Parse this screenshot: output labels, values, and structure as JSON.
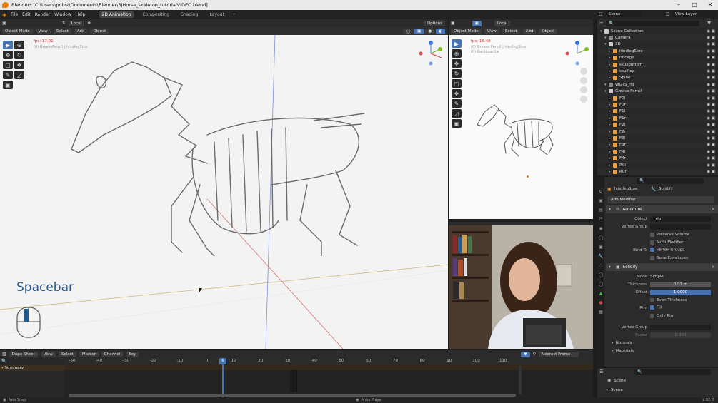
{
  "window": {
    "title": "Blender* [C:\\Users\\pobst\\Documents\\Blender\\3JHorse_skeleton_tutorialVIDEO.blend]"
  },
  "menu": [
    "File",
    "Edit",
    "Render",
    "Window",
    "Help"
  ],
  "workspaces": [
    "2D Animation",
    "Compositing",
    "Shading",
    "Layout"
  ],
  "scene_field": "Scene",
  "view_layer_field": "View Layer",
  "viewport_main": {
    "mode": "Object Mode",
    "menus": [
      "View",
      "Select",
      "Add",
      "Object"
    ],
    "orientation": "Local",
    "options": "Options",
    "fps": "fps: 17.01",
    "subtitle": "(0) GreasePencil | hindlegStoe",
    "hint": "Spacebar"
  },
  "viewport_cam": {
    "mode": "Object Mode",
    "menus": [
      "View",
      "Select",
      "Add",
      "Object"
    ],
    "orientation": "Local",
    "fps": "fps: 16.48",
    "subtitle": "(0) Grease Pencil | hindlegStoe",
    "subtitle2": "(0) Cardboard.a"
  },
  "outliner": {
    "items": [
      {
        "label": "Scene Collection",
        "color": "#cccccc",
        "indent": 0
      },
      {
        "label": "Camera",
        "color": "#888888",
        "indent": 1
      },
      {
        "label": "3D",
        "color": "#cccccc",
        "indent": 1
      },
      {
        "label": "hindlegStoe",
        "color": "#e8a040",
        "indent": 2
      },
      {
        "label": "ribcage",
        "color": "#e8a040",
        "indent": 2
      },
      {
        "label": "skullbottom",
        "color": "#e8a040",
        "indent": 2
      },
      {
        "label": "skulltop",
        "color": "#e8a040",
        "indent": 2
      },
      {
        "label": "Spine",
        "color": "#e8a040",
        "indent": 2
      },
      {
        "label": "WGTS_rig",
        "color": "#888888",
        "indent": 1
      },
      {
        "label": "Grease Pencil",
        "color": "#cccccc",
        "indent": 1
      },
      {
        "label": "F0l",
        "color": "#e8a040",
        "indent": 2
      },
      {
        "label": "F0r",
        "color": "#e8a040",
        "indent": 2
      },
      {
        "label": "F1l",
        "color": "#e8a040",
        "indent": 2
      },
      {
        "label": "F1r",
        "color": "#e8a040",
        "indent": 2
      },
      {
        "label": "F2l",
        "color": "#e8a040",
        "indent": 2
      },
      {
        "label": "F2r",
        "color": "#e8a040",
        "indent": 2
      },
      {
        "label": "F3l",
        "color": "#e8a040",
        "indent": 2
      },
      {
        "label": "F3r",
        "color": "#e8a040",
        "indent": 2
      },
      {
        "label": "F4l",
        "color": "#e8a040",
        "indent": 2
      },
      {
        "label": "F4r",
        "color": "#e8a040",
        "indent": 2
      },
      {
        "label": "R0l",
        "color": "#e8a040",
        "indent": 2
      },
      {
        "label": "R0r",
        "color": "#e8a040",
        "indent": 2
      }
    ]
  },
  "properties": {
    "object_name": "hindlegStoe",
    "modifier_name": "Solidify",
    "add_modifier": "Add Modifier",
    "armature": {
      "name": "Armature",
      "object_label": "Object",
      "object_value": "rig",
      "vgroup_label": "Vertex Group",
      "preserve_volume": "Preserve Volume",
      "multi_modifier": "Multi Modifier",
      "bind_to": "Bind To",
      "vertex_groups": "Vertex Groups",
      "bone_envelopes": "Bone Envelopes"
    },
    "solidify": {
      "name": "Solidify",
      "mode_label": "Mode",
      "mode_value": "Simple",
      "thickness_label": "Thickness",
      "thickness_value": "0.01 m",
      "offset_label": "Offset",
      "offset_value": "1.0000",
      "even_thickness": "Even Thickness",
      "rim_label": "Rim",
      "fill": "Fill",
      "only_rim": "Only Rim",
      "vgroup_label": "Vertex Group",
      "factor_label": "Factor",
      "factor_value": "0.000",
      "normals": "Normals",
      "materials": "Materials"
    }
  },
  "scene_panel": {
    "scene1": "Scene",
    "scene2": "Scene"
  },
  "dopesheet": {
    "editor": "Dope Sheet",
    "menus": [
      "View",
      "Select",
      "Marker",
      "Channel",
      "Key"
    ],
    "snap": "Nearest Frame",
    "summary": "Summary",
    "ticks": [
      -50,
      -40,
      -30,
      -20,
      -10,
      0,
      10,
      20,
      30,
      40,
      50,
      60,
      70,
      80,
      90,
      100,
      110
    ],
    "current_frame": "6"
  },
  "statusbar": {
    "left": "Axis Snap",
    "center": "Anim Player",
    "right": "2.92.0"
  },
  "colors": {
    "accent": "#4772b3",
    "selected_orange": "#e87d0d"
  }
}
